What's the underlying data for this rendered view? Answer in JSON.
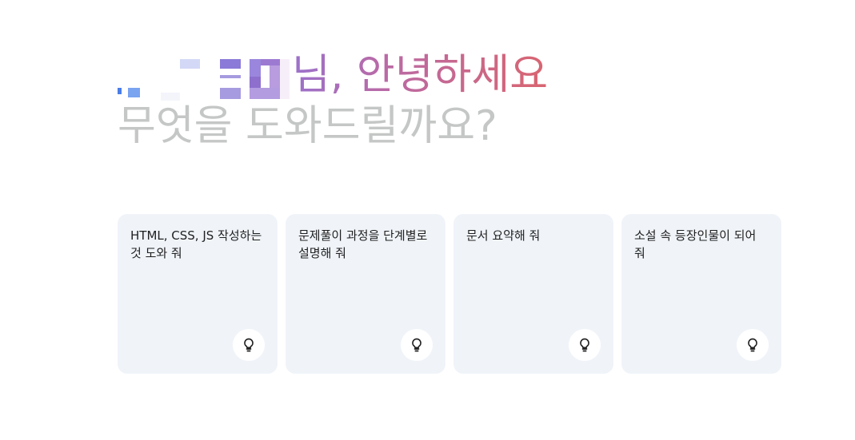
{
  "greeting": {
    "hello_suffix": "님, 안녕하세요",
    "question": "무엇을 도와드릴까요?"
  },
  "suggestions": [
    {
      "text": "HTML, CSS, JS 작성하는 것 도와 줘",
      "icon": "lightbulb-icon"
    },
    {
      "text": "문제풀이 과정을 단계별로 설명해 줘",
      "icon": "lightbulb-icon"
    },
    {
      "text": "문서 요약해 줘",
      "icon": "lightbulb-icon"
    },
    {
      "text": "소설 속 등장인물이 되어 줘",
      "icon": "lightbulb-icon"
    }
  ],
  "colors": {
    "gradient_start": "#9b72cb",
    "gradient_end": "#d96570",
    "subtitle": "#c4c7c5",
    "card_bg": "#f0f4f9"
  }
}
